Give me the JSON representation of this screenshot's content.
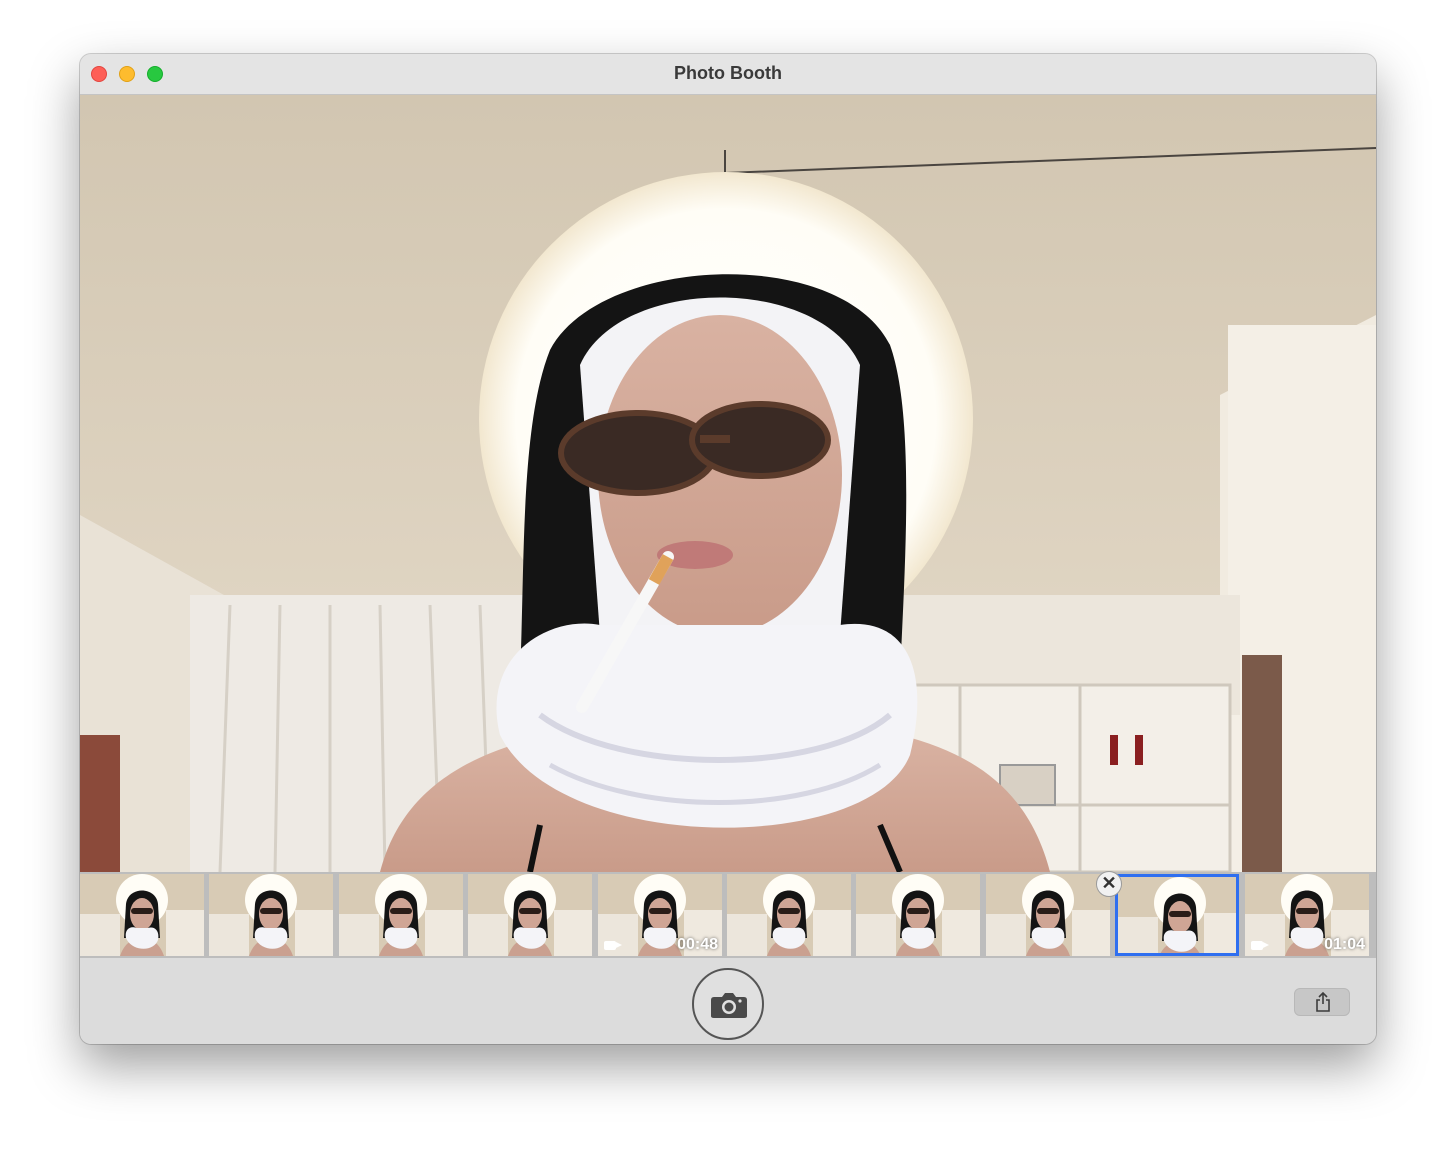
{
  "window": {
    "title": "Photo Booth"
  },
  "thumbnails": [
    {
      "type": "photo",
      "duration": "",
      "selected": false
    },
    {
      "type": "photo",
      "duration": "",
      "selected": false
    },
    {
      "type": "photo",
      "duration": "",
      "selected": false
    },
    {
      "type": "photo",
      "duration": "",
      "selected": false
    },
    {
      "type": "video",
      "duration": "00:48",
      "selected": false
    },
    {
      "type": "photo",
      "duration": "",
      "selected": false
    },
    {
      "type": "photo",
      "duration": "",
      "selected": false
    },
    {
      "type": "photo",
      "duration": "",
      "selected": false
    },
    {
      "type": "photo",
      "duration": "",
      "selected": true
    },
    {
      "type": "video",
      "duration": "01:04",
      "selected": false
    }
  ],
  "toolbar": {
    "shutter_icon": "camera-icon",
    "share_icon": "share-icon",
    "delete_icon": "close-icon"
  },
  "colors": {
    "selection": "#2f6ff0",
    "close": "#fe5f57",
    "minimize": "#febc2e",
    "zoom": "#28c840"
  }
}
